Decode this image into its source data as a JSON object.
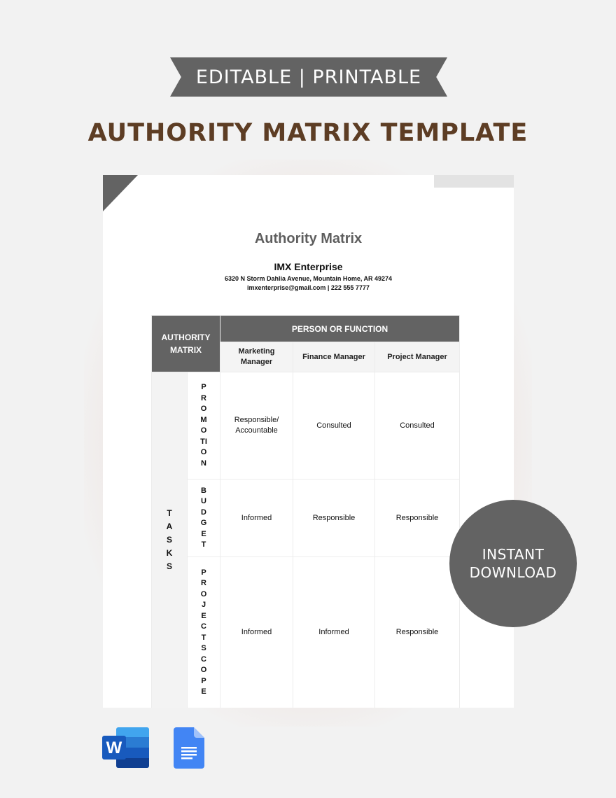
{
  "banner": {
    "label": "EDITABLE | PRINTABLE"
  },
  "headline": "AUTHORITY MATRIX TEMPLATE",
  "document": {
    "title": "Authority Matrix",
    "company": "IMX Enterprise",
    "address": "6320 N Storm Dahlia Avenue, Mountain Home, AR 49274",
    "contact": "imxenterprise@gmail.com | 222 555 7777",
    "table": {
      "corner_header": "AUTHORITY MATRIX",
      "group_header": "PERSON OR FUNCTION",
      "columns": [
        "Marketing Manager",
        "Finance Manager",
        "Project Manager"
      ],
      "row_group_label": "TASKS",
      "rows": [
        {
          "task": "PROMOTION",
          "cells": [
            "Responsible/ Accountable",
            "Consulted",
            "Consulted"
          ]
        },
        {
          "task": "BUDGET",
          "cells": [
            "Informed",
            "Responsible",
            "Responsible"
          ]
        },
        {
          "task": "PROJECT SCOPE",
          "cells": [
            "Informed",
            "Informed",
            "Responsible"
          ]
        }
      ]
    }
  },
  "badge": {
    "line1": "INSTANT",
    "line2": "DOWNLOAD"
  },
  "formats": [
    {
      "icon": "microsoft-word-icon",
      "color": "#185abd"
    },
    {
      "icon": "google-docs-icon",
      "color": "#4285f4"
    }
  ],
  "colors": {
    "accent_gray": "#636363",
    "headline_brown": "#5d3d24"
  }
}
